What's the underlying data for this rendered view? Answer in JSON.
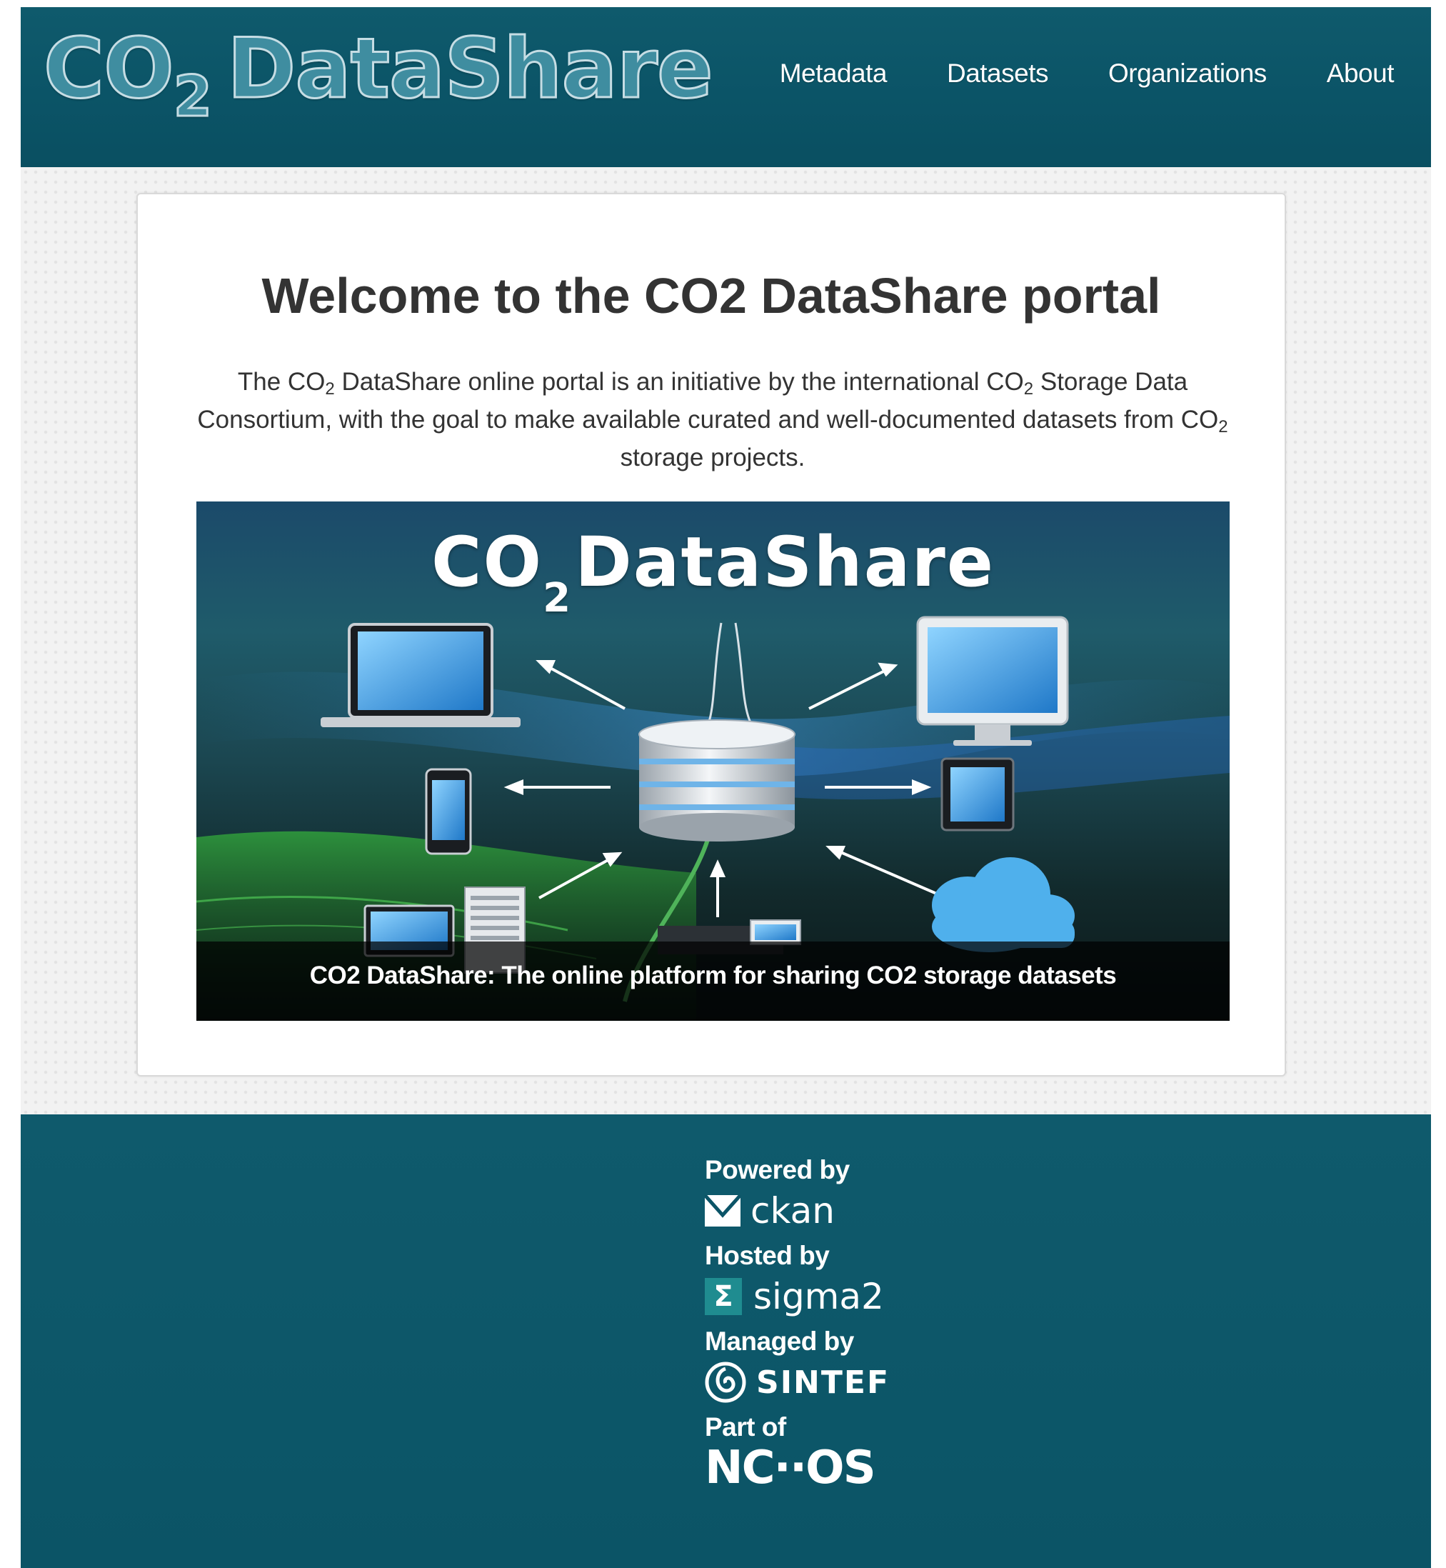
{
  "header": {
    "logo": {
      "lead": "CO",
      "sub": "2",
      "tail": "DataShare"
    },
    "nav": [
      {
        "label": "Metadata"
      },
      {
        "label": "Datasets"
      },
      {
        "label": "Organizations"
      },
      {
        "label": "About"
      }
    ]
  },
  "main": {
    "title": "Welcome to the CO2 DataShare portal",
    "intro": {
      "p1": "The CO",
      "s1": "2",
      "p2": " DataShare online portal is an initiative by the international CO",
      "s2": "2",
      "p3": " Storage Data Consortium, with the goal to make available curated and well-documented datasets from CO",
      "s3": "2",
      "p4": " storage projects."
    },
    "banner": {
      "title_lead": "CO",
      "title_sub": "2",
      "title_tail": "DataShare",
      "caption": "CO2 DataShare: The online platform for sharing CO2 storage datasets"
    }
  },
  "footer": {
    "powered_label": "Powered by",
    "powered_logo": "ckan",
    "hosted_label": "Hosted by",
    "hosted_logo_symbol": "Σ",
    "hosted_logo": "sigma2",
    "managed_label": "Managed by",
    "managed_logo": "SINTEF",
    "part_label": "Part of",
    "part_logo": "NC··OS"
  },
  "colors": {
    "header_bg": "#0b5467",
    "logo_fill": "#3f8da0",
    "page_bg": "#f2f2f2",
    "card_bg": "#ffffff",
    "text": "#333333",
    "sigma_accent": "#1f8c90"
  },
  "icons": {
    "ckan": "ckan-envelope-icon",
    "sintef": "sintef-swirl-icon",
    "banner_devices": [
      "laptop-icon",
      "monitor-icon",
      "phone-icon",
      "tablet-icon",
      "database-icon",
      "cloud-icon",
      "server-icon"
    ]
  }
}
